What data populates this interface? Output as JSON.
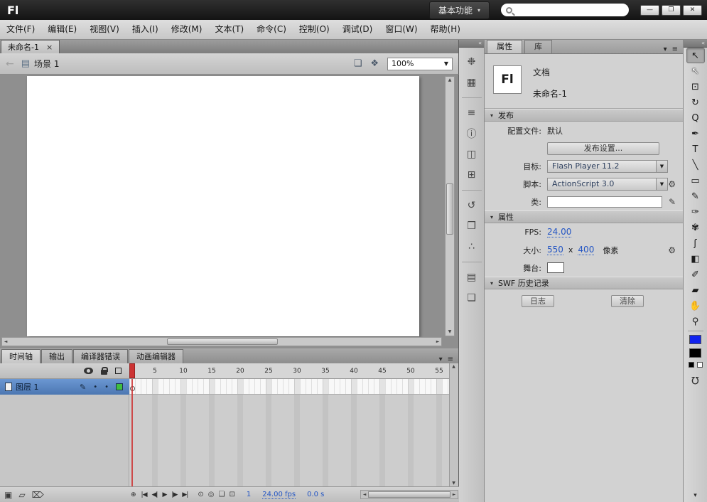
{
  "titlebar": {
    "logo": "Fl",
    "workspace": "基本功能",
    "dropdown_arrow": "▾",
    "search_value": "",
    "min_glyph": "—",
    "max_glyph": "❐",
    "close_glyph": "✕"
  },
  "menubar": {
    "items": [
      "文件(F)",
      "编辑(E)",
      "视图(V)",
      "插入(I)",
      "修改(M)",
      "文本(T)",
      "命令(C)",
      "控制(O)",
      "调试(D)",
      "窗口(W)",
      "帮助(H)"
    ]
  },
  "tabs": {
    "doc_title": "未命名-1",
    "close_glyph": "×"
  },
  "edit_bar": {
    "back_glyph": "←",
    "scene_glyph": "▤",
    "scene_label": "场景 1",
    "edit_scene_glyph": "❏",
    "edit_symbols_glyph": "❖",
    "zoom_value": "100%",
    "zoom_arrow": "▼"
  },
  "scrollbar": {
    "up": "▲",
    "down": "▼",
    "left": "◄",
    "right": "►"
  },
  "dock": {
    "expand_glyph": "«",
    "icons": [
      "❉",
      "▦",
      "≡",
      "ⓘ",
      "◫",
      "⊞",
      "↺",
      "❒",
      "∴",
      "▤",
      "❏"
    ]
  },
  "properties": {
    "tab_properties": "属性",
    "tab_library": "库",
    "arrow_glyph": "▾",
    "menu_glyph": "≡",
    "doc_logo": "Fl",
    "doc_type": "文档",
    "doc_name": "未命名-1",
    "publish": {
      "title": "发布",
      "tri": "▾",
      "profile_label": "配置文件:",
      "profile_value": "默认",
      "settings_button": "发布设置...",
      "target_label": "目标:",
      "target_value": "Flash Player 11.2",
      "script_label": "脚本:",
      "script_value": "ActionScript 3.0",
      "combo_arrow": "▼",
      "wrench_glyph": "⚙",
      "class_label": "类:",
      "class_value": "",
      "pencil_glyph": "✎"
    },
    "props": {
      "title": "属性",
      "tri": "▾",
      "fps_label": "FPS:",
      "fps_value": "24.00",
      "size_label": "大小:",
      "size_w": "550",
      "size_x": "x",
      "size_h": "400",
      "size_unit": "像素",
      "wrench_glyph": "⚙",
      "stage_label": "舞台:"
    },
    "history": {
      "title": "SWF 历史记录",
      "tri": "▾",
      "log_button": "日志",
      "clear_button": "清除"
    }
  },
  "tools": {
    "glyphs": [
      "↖",
      "↖",
      "⊡",
      "↻",
      "Q",
      "✒",
      "T",
      "╲",
      "▭",
      "✎",
      "✑",
      "✾",
      "ʃ",
      "◧",
      "✐",
      "▰",
      "✋",
      "⚲"
    ],
    "stroke_color": "#1022ee",
    "fill_color": "#000000",
    "magnet_glyph": "Ω",
    "more_glyph": "▾"
  },
  "timeline": {
    "tabs": [
      "时间轴",
      "输出",
      "编译器错误",
      "动画编辑器"
    ],
    "menu_glyph": "≡",
    "arrow_glyph": "▾",
    "layer_name": "图层 1",
    "pencil_glyph": "✎",
    "dot": "•",
    "ruler": [
      "5",
      "10",
      "15",
      "20",
      "25",
      "30",
      "35",
      "40",
      "45",
      "50",
      "55"
    ],
    "bottom": {
      "new_layer_glyph": "▣",
      "new_folder_glyph": "▱",
      "delete_glyph": "⌦",
      "center_frame_glyph": "⊕",
      "playback": [
        "|◀",
        "◀|",
        "▶",
        "|▶",
        "▶|"
      ],
      "onion": [
        "⊙",
        "◎",
        "❏",
        "⊡"
      ],
      "frame": "1",
      "fps": "24.00 fps",
      "time": "0.0 s"
    }
  },
  "colors": {
    "accent_link_blue": "#2456c4",
    "selected_layer_blue": "#4c77b2",
    "playhead_red": "#cc3333",
    "layer_outline_green": "#3fbf3f",
    "stroke_swatch": "#1022ee",
    "fill_swatch": "#000000",
    "stage_white": "#ffffff"
  }
}
